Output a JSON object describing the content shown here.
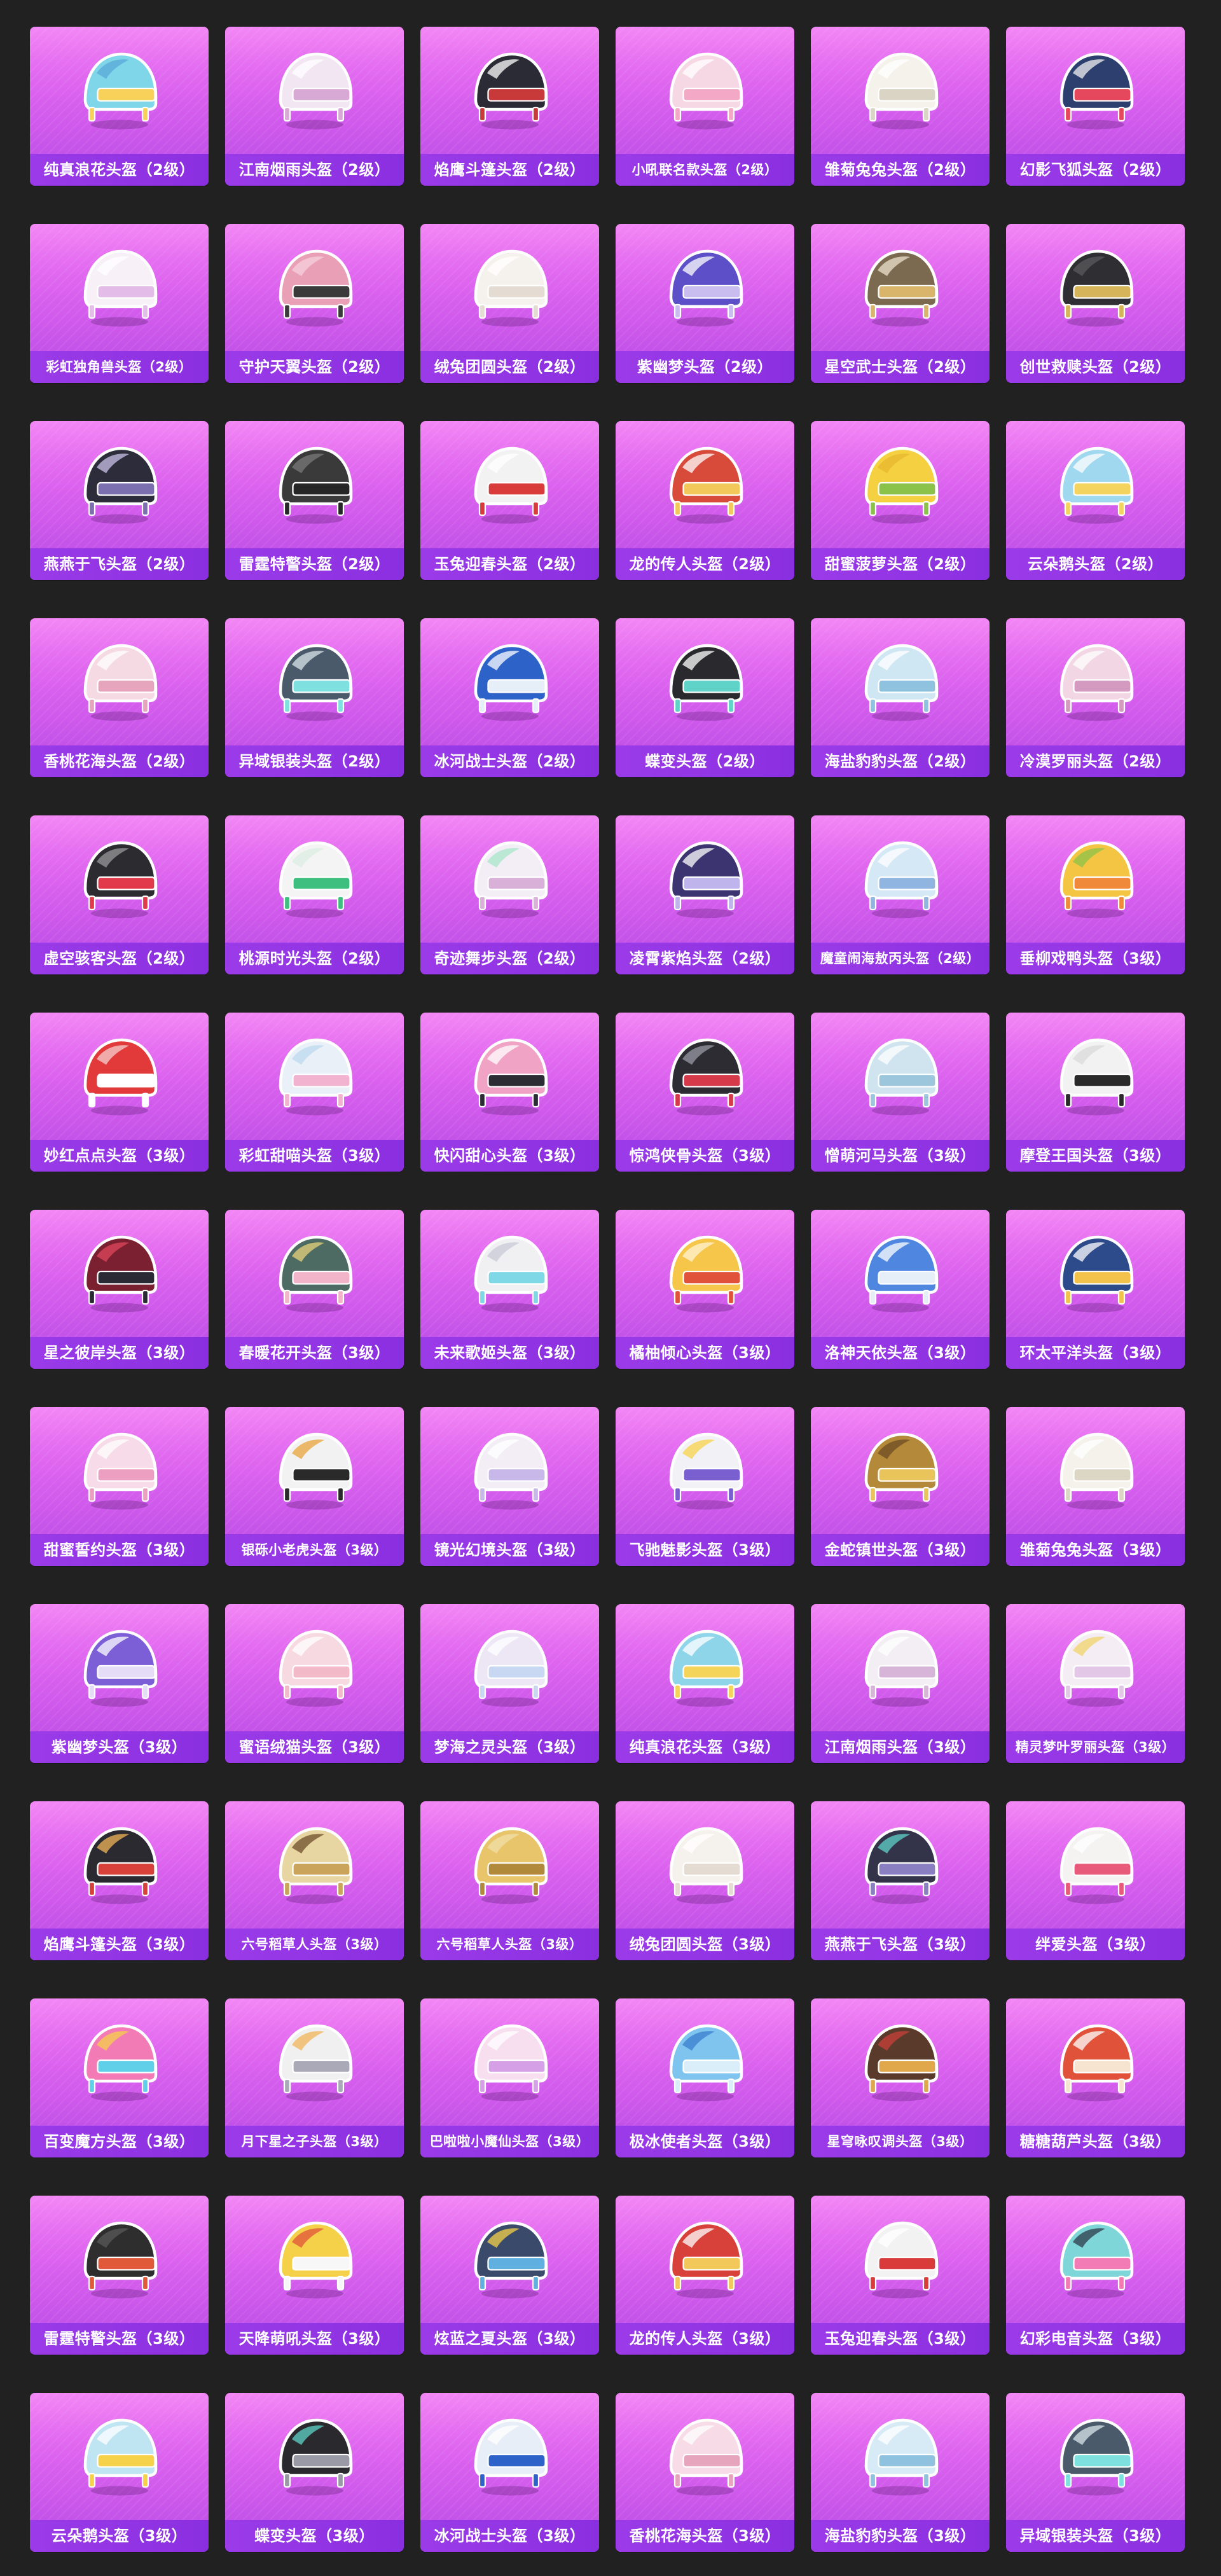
{
  "helmets": [
    {
      "name": "纯真浪花头盔（2级）",
      "colors": [
        "#7fd6e8",
        "#f7d15a",
        "#5aa8d8"
      ],
      "icon": "helmet-icon"
    },
    {
      "name": "江南烟雨头盔（2级）",
      "colors": [
        "#f1e6f2",
        "#d9a9d6",
        "#ffffff"
      ],
      "icon": "helmet-icon"
    },
    {
      "name": "焰鹰斗篷头盔（2级）",
      "colors": [
        "#2b2b35",
        "#c83a3a",
        "#ffffff"
      ],
      "icon": "helmet-icon"
    },
    {
      "name": "小吼联名款头盔（2级）",
      "colors": [
        "#f6d7e4",
        "#f3a9c5",
        "#ffffff"
      ],
      "icon": "helmet-icon"
    },
    {
      "name": "雏菊兔兔头盔（2级）",
      "colors": [
        "#f4f2ea",
        "#d9d4c3",
        "#ffffff"
      ],
      "icon": "helmet-icon"
    },
    {
      "name": "幻影飞狐头盔（2级）",
      "colors": [
        "#2c3f6e",
        "#e5475c",
        "#f2f2f2"
      ],
      "icon": "helmet-icon"
    },
    {
      "name": "彩虹独角兽头盔（2级）",
      "colors": [
        "#f7f0f7",
        "#e3bde8",
        "#ffffff"
      ],
      "icon": "helmet-icon"
    },
    {
      "name": "守护天翼头盔（2级）",
      "colors": [
        "#e9a0b6",
        "#3a3a3a",
        "#f5d0dc"
      ],
      "icon": "helmet-icon"
    },
    {
      "name": "绒兔团圆头盔（2级）",
      "colors": [
        "#f5f2ee",
        "#e4dcd2",
        "#ffffff"
      ],
      "icon": "helmet-icon"
    },
    {
      "name": "紫幽梦头盔（2级）",
      "colors": [
        "#5c4fc7",
        "#c9bdf0",
        "#ffffff"
      ],
      "icon": "helmet-icon"
    },
    {
      "name": "星空武士头盔（2级）",
      "colors": [
        "#7b6a4f",
        "#d9b46b",
        "#ece3cf"
      ],
      "icon": "helmet-icon"
    },
    {
      "name": "创世救赎头盔（2级）",
      "colors": [
        "#2f2f33",
        "#d6b55a",
        "#5b5b5e"
      ],
      "icon": "helmet-icon"
    },
    {
      "name": "燕燕于飞头盔（2级）",
      "colors": [
        "#2c2c3a",
        "#7b6fb0",
        "#c9c0e8"
      ],
      "icon": "helmet-icon"
    },
    {
      "name": "雷霆特警头盔（2级）",
      "colors": [
        "#3a3a3a",
        "#262626",
        "#7a7a7a"
      ],
      "icon": "helmet-icon"
    },
    {
      "name": "玉兔迎春头盔（2级）",
      "colors": [
        "#f2f2f2",
        "#d93a3a",
        "#ffffff"
      ],
      "icon": "helmet-icon"
    },
    {
      "name": "龙的传人头盔（2级）",
      "colors": [
        "#d84a3a",
        "#f2c85a",
        "#ffffff"
      ],
      "icon": "helmet-icon"
    },
    {
      "name": "甜蜜菠萝头盔（2级）",
      "colors": [
        "#f5d142",
        "#8bc34a",
        "#e6b52e"
      ],
      "icon": "helmet-icon"
    },
    {
      "name": "云朵鹅头盔（2级）",
      "colors": [
        "#9fd8ef",
        "#f4d35e",
        "#ffffff"
      ],
      "icon": "helmet-icon"
    },
    {
      "name": "香桃花海头盔（2级）",
      "colors": [
        "#f5d9e3",
        "#e7a4bd",
        "#ffffff"
      ],
      "icon": "helmet-icon"
    },
    {
      "name": "异域银装头盔（2级）",
      "colors": [
        "#4a5a6b",
        "#7fe0e0",
        "#d9e6ea"
      ],
      "icon": "helmet-icon"
    },
    {
      "name": "冰河战士头盔（2级）",
      "colors": [
        "#2d62c9",
        "#e6eef8",
        "#ffffff"
      ],
      "icon": "helmet-icon"
    },
    {
      "name": "蝶变头盔（2级）",
      "colors": [
        "#2a2a2e",
        "#5fd3c8",
        "#ffffff"
      ],
      "icon": "helmet-icon"
    },
    {
      "name": "海盐豹豹头盔（2级）",
      "colors": [
        "#cfe6f3",
        "#8ec2de",
        "#ffffff"
      ],
      "icon": "helmet-icon"
    },
    {
      "name": "冷漠罗丽头盔（2级）",
      "colors": [
        "#f2d6e4",
        "#d59ac0",
        "#ffffff"
      ],
      "icon": "helmet-icon"
    },
    {
      "name": "虚空骇客头盔（2级）",
      "colors": [
        "#2b2b30",
        "#e23a4a",
        "#9a9a9a"
      ],
      "icon": "helmet-icon"
    },
    {
      "name": "桃源时光头盔（2级）",
      "colors": [
        "#f4f4f4",
        "#3fbf7f",
        "#dbeee3"
      ],
      "icon": "helmet-icon"
    },
    {
      "name": "奇迹舞步头盔（2级）",
      "colors": [
        "#f3eef5",
        "#d8b0d8",
        "#a8e6c8"
      ],
      "icon": "helmet-icon"
    },
    {
      "name": "凌霄紫焰头盔（2级）",
      "colors": [
        "#3c3470",
        "#bfb4ec",
        "#ffffff"
      ],
      "icon": "helmet-icon"
    },
    {
      "name": "魔童闹海敖丙头盔（2级）",
      "colors": [
        "#d5e8f5",
        "#8fb5e0",
        "#ffffff"
      ],
      "icon": "helmet-icon"
    },
    {
      "name": "垂柳戏鸭头盔（3级）",
      "colors": [
        "#f4c542",
        "#f08a3a",
        "#8bc34a"
      ],
      "icon": "helmet-icon"
    },
    {
      "name": "妙红点点头盔（3级）",
      "colors": [
        "#e23a3a",
        "#ffffff",
        "#f5d0d0"
      ],
      "icon": "helmet-icon"
    },
    {
      "name": "彩虹甜喵头盔（3级）",
      "colors": [
        "#e9f0f8",
        "#f2b3d0",
        "#bcd9f0"
      ],
      "icon": "helmet-icon"
    },
    {
      "name": "快闪甜心头盔（3级）",
      "colors": [
        "#f0a3c4",
        "#2c2c35",
        "#ffffff"
      ],
      "icon": "helmet-icon"
    },
    {
      "name": "惊鸿侠骨头盔（3级）",
      "colors": [
        "#2c2c32",
        "#d63a4a",
        "#9a9aa6"
      ],
      "icon": "helmet-icon"
    },
    {
      "name": "憎萌河马头盔（3级）",
      "colors": [
        "#cfe4ef",
        "#9cc6dc",
        "#ffffff"
      ],
      "icon": "helmet-icon"
    },
    {
      "name": "摩登王国头盔（3级）",
      "colors": [
        "#f2f2f2",
        "#2a2a2a",
        "#d9d9d9"
      ],
      "icon": "helmet-icon"
    },
    {
      "name": "星之彼岸头盔（3级）",
      "colors": [
        "#7a2030",
        "#2a2a35",
        "#e0475e"
      ],
      "icon": "helmet-icon"
    },
    {
      "name": "春暖花开头盔（3级）",
      "colors": [
        "#4d6b63",
        "#f2b4c8",
        "#e7d27a"
      ],
      "icon": "helmet-icon"
    },
    {
      "name": "未来歌姬头盔（3级）",
      "colors": [
        "#f0f0f2",
        "#7ed8e6",
        "#c9c9d6"
      ],
      "icon": "helmet-icon"
    },
    {
      "name": "橘柚倾心头盔（3级）",
      "colors": [
        "#f5c64a",
        "#e0523a",
        "#fff3d6"
      ],
      "icon": "helmet-icon"
    },
    {
      "name": "洛神天依头盔（3级）",
      "colors": [
        "#4f86e0",
        "#e6eef8",
        "#ffffff"
      ],
      "icon": "helmet-icon"
    },
    {
      "name": "环太平洋头盔（3级）",
      "colors": [
        "#2d4a8a",
        "#f3c24a",
        "#ffffff"
      ],
      "icon": "helmet-icon"
    },
    {
      "name": "甜蜜誓约头盔（3级）",
      "colors": [
        "#f7dbe8",
        "#ec9fc0",
        "#ffffff"
      ],
      "icon": "helmet-icon"
    },
    {
      "name": "银砾小老虎头盔（3级）",
      "colors": [
        "#f2f2f2",
        "#2a2a2a",
        "#e7a43a"
      ],
      "icon": "helmet-icon"
    },
    {
      "name": "镜光幻境头盔（3级）",
      "colors": [
        "#f3eef5",
        "#c8b8ea",
        "#ffffff"
      ],
      "icon": "helmet-icon"
    },
    {
      "name": "飞驰魅影头盔（3级）",
      "colors": [
        "#f2f2f6",
        "#7a5fd0",
        "#f5d24a"
      ],
      "icon": "helmet-icon"
    },
    {
      "name": "金蛇镇世头盔（3级）",
      "colors": [
        "#b5893a",
        "#e8c45a",
        "#6e4c24"
      ],
      "icon": "helmet-icon"
    },
    {
      "name": "雏菊兔兔头盔（3级）",
      "colors": [
        "#f4f2ea",
        "#dcd6c4",
        "#ffffff"
      ],
      "icon": "helmet-icon"
    },
    {
      "name": "紫幽梦头盔（3级）",
      "colors": [
        "#7c5ed6",
        "#e5dcf7",
        "#ffffff"
      ],
      "icon": "helmet-icon"
    },
    {
      "name": "蜜语绒猫头盔（3级）",
      "colors": [
        "#f7d9e2",
        "#f2b9c9",
        "#ffffff"
      ],
      "icon": "helmet-icon"
    },
    {
      "name": "梦海之灵头盔（3级）",
      "colors": [
        "#ece6f5",
        "#c8d8f2",
        "#ffffff"
      ],
      "icon": "helmet-icon"
    },
    {
      "name": "纯真浪花头盔（3级）",
      "colors": [
        "#8fd5ea",
        "#f5d45a",
        "#ffffff"
      ],
      "icon": "helmet-icon"
    },
    {
      "name": "江南烟雨头盔（3级）",
      "colors": [
        "#f3eef4",
        "#d7b5d8",
        "#ffffff"
      ],
      "icon": "helmet-icon"
    },
    {
      "name": "精灵梦叶罗丽头盔（3级）",
      "colors": [
        "#f4eef4",
        "#e2c8e6",
        "#f0d36a"
      ],
      "icon": "helmet-icon"
    },
    {
      "name": "焰鹰斗篷头盔（3级）",
      "colors": [
        "#2a2a30",
        "#d8403a",
        "#f0b45a"
      ],
      "icon": "helmet-icon"
    },
    {
      "name": "六号稻草人头盔（3级）",
      "colors": [
        "#e8d6a2",
        "#c9a45a",
        "#6e4e2a"
      ],
      "icon": "helmet-icon"
    },
    {
      "name": "六号稻草人头盔（3级）",
      "colors": [
        "#e8c46a",
        "#b08a3a",
        "#f2e0a8"
      ],
      "icon": "helmet-icon"
    },
    {
      "name": "绒兔团圆头盔（3级）",
      "colors": [
        "#f5f2ee",
        "#e4dcd2",
        "#ffffff"
      ],
      "icon": "helmet-icon"
    },
    {
      "name": "燕燕于飞头盔（3级）",
      "colors": [
        "#33334a",
        "#8a7fc0",
        "#5fd3c8"
      ],
      "icon": "helmet-icon"
    },
    {
      "name": "绊爱头盔（3级）",
      "colors": [
        "#f5f2f2",
        "#e85a7a",
        "#ffffff"
      ],
      "icon": "helmet-icon"
    },
    {
      "name": "百变魔方头盔（3级）",
      "colors": [
        "#f27ab5",
        "#5fd0e8",
        "#f5d24a"
      ],
      "icon": "helmet-icon"
    },
    {
      "name": "月下星之子头盔（3级）",
      "colors": [
        "#f0f0f0",
        "#a9a9b8",
        "#f0b45a"
      ],
      "icon": "helmet-icon"
    },
    {
      "name": "巴啦啦小魔仙头盔（3级）",
      "colors": [
        "#f7dff0",
        "#d6a0e6",
        "#ffffff"
      ],
      "icon": "helmet-icon"
    },
    {
      "name": "极冰使者头盔（3级）",
      "colors": [
        "#7fc4ef",
        "#d9eef8",
        "#3a7fcf"
      ],
      "icon": "helmet-icon"
    },
    {
      "name": "星穹咏叹调头盔（3级）",
      "colors": [
        "#5a3a2a",
        "#e0a84a",
        "#c8403a"
      ],
      "icon": "helmet-icon"
    },
    {
      "name": "糖糖葫芦头盔（3级）",
      "colors": [
        "#e0523a",
        "#f7e4d0",
        "#ffffff"
      ],
      "icon": "helmet-icon"
    },
    {
      "name": "雷霆特警头盔（3级）",
      "colors": [
        "#2e2e2e",
        "#e05a3a",
        "#5a5a5a"
      ],
      "icon": "helmet-icon"
    },
    {
      "name": "天降萌吼头盔（3级）",
      "colors": [
        "#f5d14a",
        "#f7f7f7",
        "#e0523a"
      ],
      "icon": "helmet-icon"
    },
    {
      "name": "炫蓝之夏头盔（3级）",
      "colors": [
        "#3a4a6a",
        "#5fb0e0",
        "#f5d24a"
      ],
      "icon": "helmet-icon"
    },
    {
      "name": "龙的传人头盔（3级）",
      "colors": [
        "#d8403a",
        "#f2c85a",
        "#ffffff"
      ],
      "icon": "helmet-icon"
    },
    {
      "name": "玉兔迎春头盔（3级）",
      "colors": [
        "#f2f2f2",
        "#d93a3a",
        "#ffffff"
      ],
      "icon": "helmet-icon"
    },
    {
      "name": "幻彩电音头盔（3级）",
      "colors": [
        "#7fd6d8",
        "#f27ab5",
        "#2c3a4a"
      ],
      "icon": "helmet-icon"
    },
    {
      "name": "云朵鹅头盔（3级）",
      "colors": [
        "#bfe4f2",
        "#f5d24a",
        "#ffffff"
      ],
      "icon": "helmet-icon"
    },
    {
      "name": "蝶变头盔（3级）",
      "colors": [
        "#2a2a2e",
        "#9a9aa6",
        "#5fd3c8"
      ],
      "icon": "helmet-icon"
    },
    {
      "name": "冰河战士头盔（3级）",
      "colors": [
        "#e8eef8",
        "#2d62c9",
        "#ffffff"
      ],
      "icon": "helmet-icon"
    },
    {
      "name": "香桃花海头盔（3级）",
      "colors": [
        "#f7dbe6",
        "#e7a4bd",
        "#ffffff"
      ],
      "icon": "helmet-icon"
    },
    {
      "name": "海盐豹豹头盔（3级）",
      "colors": [
        "#d7ebf6",
        "#8ec2de",
        "#ffffff"
      ],
      "icon": "helmet-icon"
    },
    {
      "name": "异域银装头盔（3级）",
      "colors": [
        "#4a5a6b",
        "#7fe0e0",
        "#d9e6ea"
      ],
      "icon": "helmet-icon"
    }
  ]
}
